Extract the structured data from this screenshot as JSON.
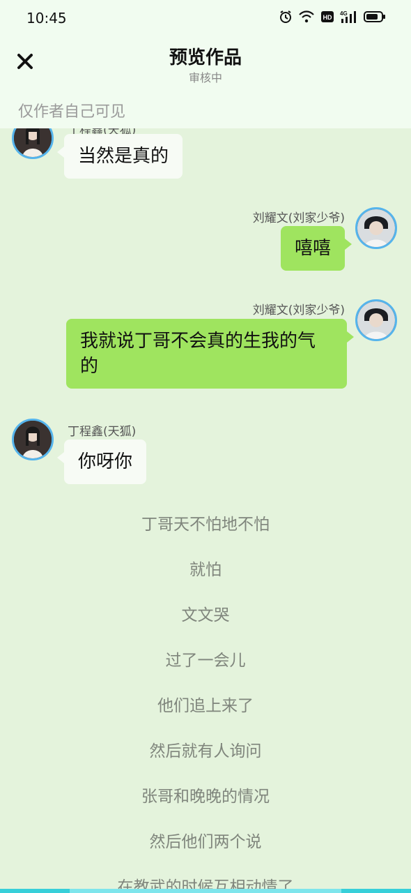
{
  "status_bar": {
    "time": "10:45",
    "icons": [
      "alarm-icon",
      "wifi-icon",
      "hd-icon",
      "signal-4g-icon",
      "battery-icon"
    ]
  },
  "header": {
    "title": "预览作品",
    "subtitle": "审核中",
    "visibility_note": "仅作者自己可见",
    "close_icon": "close-icon"
  },
  "messages": [
    {
      "side": "left",
      "sender": "丁程鑫(天狐)",
      "text": "当然是真的"
    },
    {
      "side": "right",
      "sender": "刘耀文(刘家少爷)",
      "text": "嘻嘻"
    },
    {
      "side": "right",
      "sender": "刘耀文(刘家少爷)",
      "text_line1": "我就说丁哥不会真的生我的气",
      "text_line2": "的"
    },
    {
      "side": "left",
      "sender": "丁程鑫(天狐)",
      "text": "你呀你"
    }
  ],
  "narration": [
    "丁哥天不怕地不怕",
    "就怕",
    "文文哭",
    "过了一会儿",
    "他们追上来了",
    "然后就有人询问",
    "张哥和晚晚的情况",
    "然后他们两个说",
    "在教武的时候互相动情了"
  ],
  "colors": {
    "background": "#e4f3dc",
    "header_bg": "#f1fcf0",
    "right_bubble": "#9fe45f",
    "left_bubble": "#f7fbf5",
    "avatar_border": "#55b4ec",
    "bottom_bar": "#37cfd9"
  }
}
